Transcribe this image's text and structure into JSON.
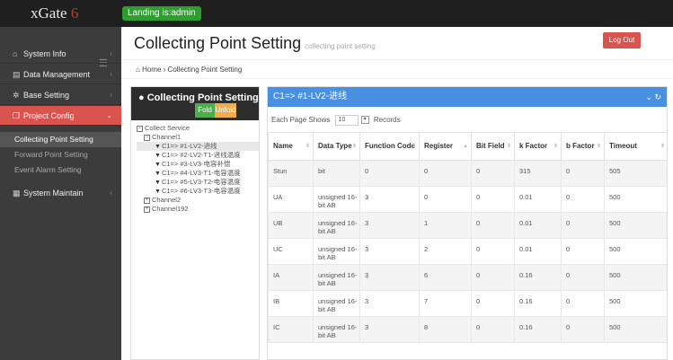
{
  "app": {
    "logo": "xGate",
    "version": "6",
    "landing": "Landing is:admin"
  },
  "sidebar": {
    "items": [
      {
        "label": "System Info",
        "icon": "home-icon",
        "glyph": "⌂"
      },
      {
        "label": "Data Management",
        "icon": "grid-icon",
        "glyph": "▤"
      },
      {
        "label": "Base Setting",
        "icon": "gears-icon",
        "glyph": "✲"
      },
      {
        "label": "Project Config",
        "icon": "bookmark-icon",
        "glyph": "❐"
      }
    ],
    "subitems": [
      {
        "label": "Collecting Point Setting"
      },
      {
        "label": "Forward Point Setting"
      },
      {
        "label": "Event Alarm Setting"
      }
    ],
    "maintain": {
      "label": "System Maintain",
      "icon": "calendar-icon",
      "glyph": "▦"
    }
  },
  "header": {
    "title": "Collecting Point Setting",
    "subtitle": "collecting point setting",
    "logout": "Log Out"
  },
  "breadcrumb": {
    "home": "Home",
    "current": "Collecting Point Setting"
  },
  "left_panel": {
    "title": "Collecting Point Setting",
    "fold": "Fold",
    "unfold": "Unfold",
    "tree": {
      "root": "Collect Service",
      "channel1": "Channel1",
      "points": [
        "C1=> #1-LV2-进线",
        "C1=> #2-LV2-T1-进线温度",
        "C1=> #3-LV3-电容补偿",
        "C1=> #4-LV3-T1-电容温度",
        "C1=> #5-LV3-T2-电容温度",
        "C1=> #6-LV3-T3-电容温度"
      ],
      "channel2": "Channel2",
      "channel192": "Channel192"
    }
  },
  "right_panel": {
    "title": "C1=> #1-LV2-进线",
    "records": {
      "prefix": "Each Page Shows",
      "value": "10",
      "suffix": "Records"
    },
    "columns": [
      "Name",
      "Data Type",
      "Function Code",
      "Register",
      "Bit Field",
      "k Factor",
      "b Factor",
      "Timeout"
    ],
    "rows": [
      [
        "Stun",
        "bit",
        "0",
        "0",
        "0",
        "315",
        "0",
        "505"
      ],
      [
        "UA",
        "unsigned 16-bit AB",
        "3",
        "0",
        "0",
        "0.01",
        "0",
        "500"
      ],
      [
        "UB",
        "unsigned 16-bit AB",
        "3",
        "1",
        "0",
        "0.01",
        "0",
        "500"
      ],
      [
        "UC",
        "unsigned 16-bit AB",
        "3",
        "2",
        "0",
        "0.01",
        "0",
        "500"
      ],
      [
        "IA",
        "unsigned 16-bit AB",
        "3",
        "6",
        "0",
        "0.16",
        "0",
        "500"
      ],
      [
        "IB",
        "unsigned 16-bit AB",
        "3",
        "7",
        "0",
        "0.16",
        "0",
        "500"
      ],
      [
        "IC",
        "unsigned 16-bit AB",
        "3",
        "8",
        "0",
        "0.16",
        "0",
        "500"
      ]
    ]
  },
  "colors": {
    "accent_red": "#d9534f",
    "panel_blue": "#4a90e2",
    "green": "#4cae4c",
    "orange": "#f0ad4e"
  }
}
